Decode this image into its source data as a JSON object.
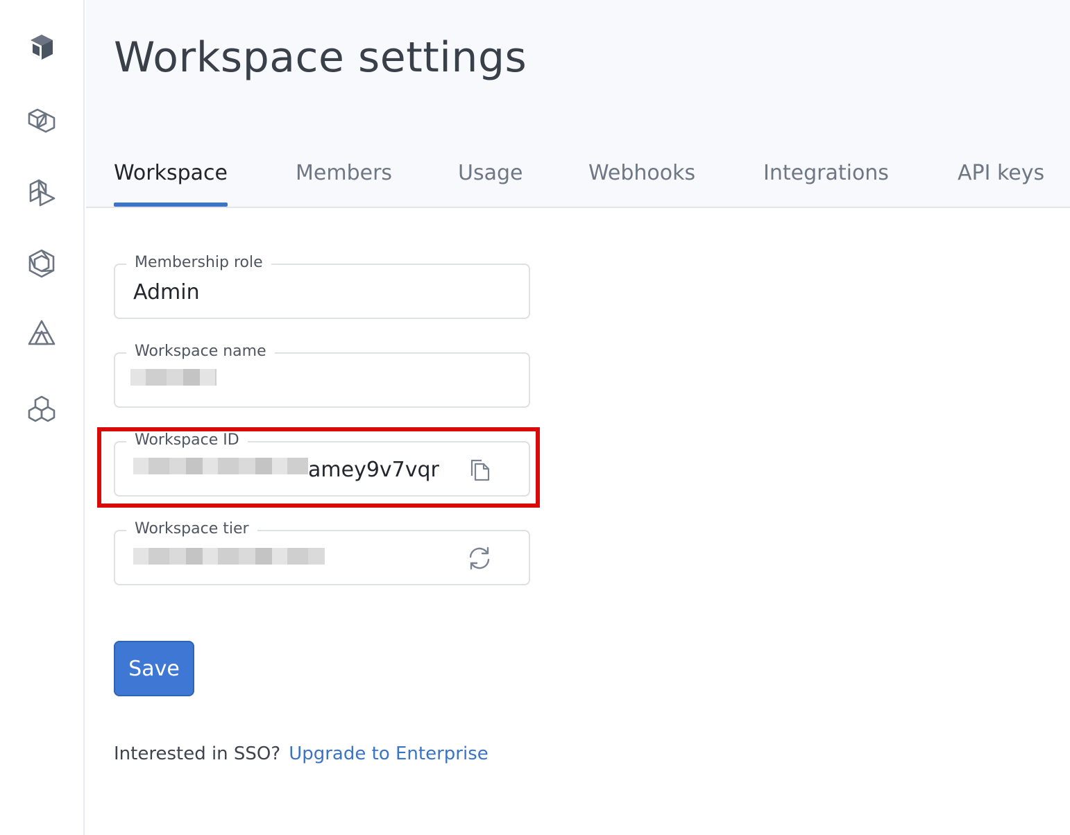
{
  "sidebar": {
    "items": [
      {
        "icon": "cube-logo-icon"
      },
      {
        "icon": "stacked-cubes-icon"
      },
      {
        "icon": "play-blocks-icon"
      },
      {
        "icon": "hexagon-network-icon"
      },
      {
        "icon": "triangle-pyramid-icon"
      },
      {
        "icon": "hexagon-cluster-icon"
      }
    ]
  },
  "header": {
    "title": "Workspace settings",
    "tabs": [
      {
        "label": "Workspace",
        "active": true
      },
      {
        "label": "Members",
        "active": false
      },
      {
        "label": "Usage",
        "active": false
      },
      {
        "label": "Webhooks",
        "active": false
      },
      {
        "label": "Integrations",
        "active": false
      },
      {
        "label": "API keys",
        "active": false
      }
    ]
  },
  "form": {
    "membership_role": {
      "label": "Membership role",
      "value": "Admin"
    },
    "workspace_name": {
      "label": "Workspace name",
      "value": ""
    },
    "workspace_id": {
      "label": "Workspace ID",
      "value_visible_suffix": "amey9v7vqr",
      "action_icon": "copy-icon"
    },
    "workspace_tier": {
      "label": "Workspace tier",
      "value": "",
      "action_icon": "refresh-icon"
    },
    "save_label": "Save"
  },
  "sso": {
    "text": "Interested in SSO?",
    "link": "Upgrade to Enterprise"
  },
  "colors": {
    "accent": "#3e78d4",
    "highlight": "#d90a0a",
    "link": "#3a73c9"
  }
}
